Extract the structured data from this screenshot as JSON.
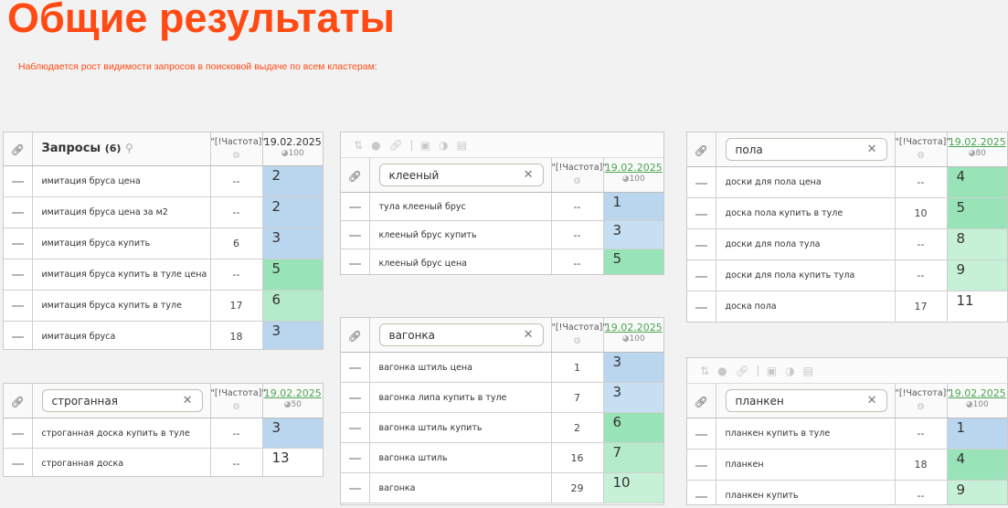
{
  "title": "Общие результаты",
  "subtitle": "Наблюдается рост видимости запросов в поисковой выдаче по всем кластерам:",
  "freq_header": "\"[!Частота]\"",
  "tables": [
    {
      "id": "t1",
      "name_label": "Запросы",
      "count": "(6)",
      "search": "",
      "date": "19.02.2025",
      "date_linked": false,
      "cnt": "100",
      "rows": [
        {
          "query": "имитация бруса цена",
          "freq": "--",
          "pos": "2",
          "bg": "blue"
        },
        {
          "query": "имитация бруса цена за м2",
          "freq": "--",
          "pos": "2",
          "bg": "blue"
        },
        {
          "query": "имитация бруса купить",
          "freq": "6",
          "pos": "3",
          "bg": "blue"
        },
        {
          "query": "имитация бруса купить в туле цена",
          "freq": "--",
          "pos": "5",
          "bg": "green"
        },
        {
          "query": "имитация бруса купить в туле",
          "freq": "17",
          "pos": "6",
          "bg": "green2"
        },
        {
          "query": "имитация бруса",
          "freq": "18",
          "pos": "3",
          "bg": "blue"
        }
      ]
    },
    {
      "id": "t2",
      "search": "строганная",
      "date": "19.02.2025",
      "date_linked": true,
      "cnt": "50",
      "rows": [
        {
          "query": "строганная доска купить в туле",
          "freq": "--",
          "pos": "3",
          "bg": "blue"
        },
        {
          "query": "строганная доска",
          "freq": "--",
          "pos": "13",
          "bg": "white"
        }
      ]
    },
    {
      "id": "t3",
      "search": "клееный",
      "date": "19.02.2025",
      "date_linked": true,
      "cnt": "100",
      "rows": [
        {
          "query": "тула клееный брус",
          "freq": "--",
          "pos": "1",
          "bg": "blue"
        },
        {
          "query": "клееный брус купить",
          "freq": "--",
          "pos": "3",
          "bg": "blue2"
        },
        {
          "query": "клееный брус цена",
          "freq": "--",
          "pos": "5",
          "bg": "green"
        }
      ]
    },
    {
      "id": "t4",
      "search": "вагонка",
      "date": "19.02.2025",
      "date_linked": true,
      "cnt": "100",
      "rows": [
        {
          "query": "вагонка штиль цена",
          "freq": "1",
          "pos": "3",
          "bg": "blue"
        },
        {
          "query": "вагонка липа купить в туле",
          "freq": "7",
          "pos": "3",
          "bg": "blue2"
        },
        {
          "query": "вагонка штиль купить",
          "freq": "2",
          "pos": "6",
          "bg": "green"
        },
        {
          "query": "вагонка штиль",
          "freq": "16",
          "pos": "7",
          "bg": "green2"
        },
        {
          "query": "вагонка",
          "freq": "29",
          "pos": "10",
          "bg": "green3"
        }
      ]
    },
    {
      "id": "t5",
      "search": "пола",
      "date": "19.02.2025",
      "date_linked": true,
      "cnt": "80",
      "rows": [
        {
          "query": "доски для пола цена",
          "freq": "--",
          "pos": "4",
          "bg": "green"
        },
        {
          "query": "доска пола купить в туле",
          "freq": "10",
          "pos": "5",
          "bg": "green"
        },
        {
          "query": "доски для пола тула",
          "freq": "--",
          "pos": "8",
          "bg": "green3"
        },
        {
          "query": "доски для пола купить тула",
          "freq": "--",
          "pos": "9",
          "bg": "green3"
        },
        {
          "query": "доска пола",
          "freq": "17",
          "pos": "11",
          "bg": "white"
        }
      ]
    },
    {
      "id": "t6",
      "search": "планкен",
      "date": "19.02.2025",
      "date_linked": true,
      "cnt": "100",
      "rows": [
        {
          "query": "планкен купить в туле",
          "freq": "--",
          "pos": "1",
          "bg": "blue"
        },
        {
          "query": "планкен",
          "freq": "18",
          "pos": "4",
          "bg": "green"
        },
        {
          "query": "планкен купить",
          "freq": "--",
          "pos": "9",
          "bg": "green3"
        }
      ]
    }
  ]
}
